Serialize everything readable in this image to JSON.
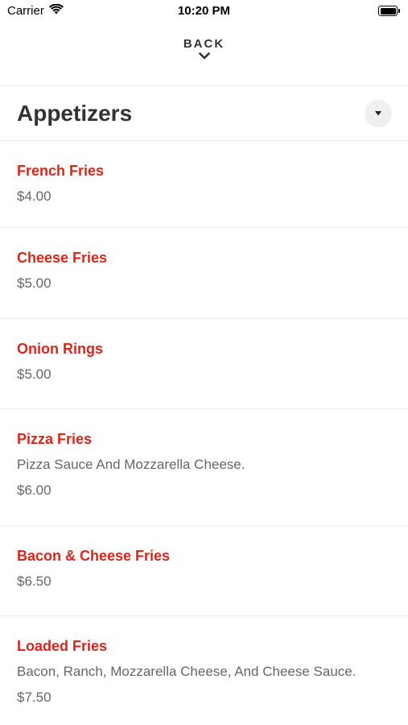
{
  "status_bar": {
    "carrier": "Carrier",
    "time": "10:20 PM"
  },
  "nav": {
    "back_label": "BACK"
  },
  "section": {
    "title": "Appetizers"
  },
  "menu_items": [
    {
      "name": "French Fries",
      "description": "",
      "price": "$4.00"
    },
    {
      "name": "Cheese Fries",
      "description": "",
      "price": "$5.00"
    },
    {
      "name": "Onion Rings",
      "description": "",
      "price": "$5.00"
    },
    {
      "name": "Pizza Fries",
      "description": "Pizza Sauce And Mozzarella Cheese.",
      "price": "$6.00"
    },
    {
      "name": "Bacon & Cheese Fries",
      "description": "",
      "price": "$6.50"
    },
    {
      "name": "Loaded Fries",
      "description": "Bacon, Ranch, Mozzarella Cheese, And Cheese Sauce.",
      "price": "$7.50"
    }
  ],
  "colors": {
    "item_name": "#d8261b",
    "text": "#333333",
    "muted": "#666666",
    "divider": "#ececec"
  }
}
